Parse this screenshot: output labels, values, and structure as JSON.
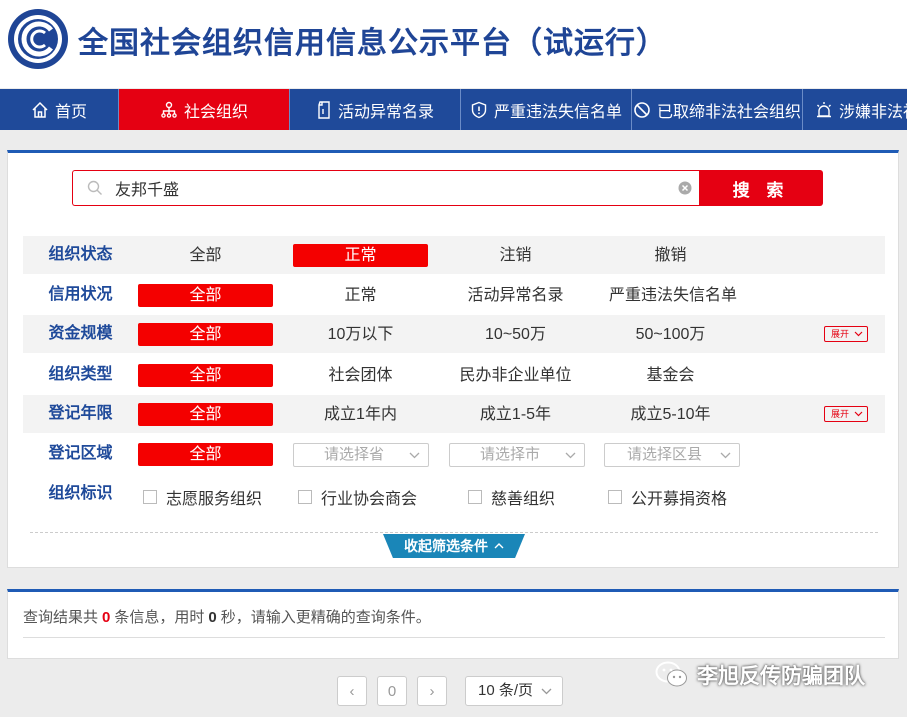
{
  "header": {
    "title": "全国社会组织信用信息公示平台（试运行）",
    "logo_icon": "platform-emblem-icon"
  },
  "nav": {
    "items": [
      {
        "label": "首页",
        "icon": "home-icon"
      },
      {
        "label": "社会组织",
        "icon": "org-tree-icon",
        "active": true
      },
      {
        "label": "活动异常名录",
        "icon": "document-icon"
      },
      {
        "label": "严重违法失信名单",
        "icon": "shield-alert-icon"
      },
      {
        "label": "已取缔非法社会组织",
        "icon": "prohibited-icon"
      },
      {
        "label": "涉嫌非法社",
        "icon": "alarm-light-icon"
      }
    ]
  },
  "search": {
    "value": "友邦千盛",
    "button_label": "搜 索"
  },
  "filters": {
    "status": {
      "label": "组织状态",
      "options": [
        "全部",
        "正常",
        "注销",
        "撤销"
      ],
      "selected": "正常"
    },
    "credit": {
      "label": "信用状况",
      "options": [
        "全部",
        "正常",
        "活动异常名录",
        "严重违法失信名单"
      ],
      "selected": "全部"
    },
    "capital": {
      "label": "资金规模",
      "options": [
        "全部",
        "10万以下",
        "10~50万",
        "50~100万"
      ],
      "selected": "全部",
      "expand_label": "展开"
    },
    "type": {
      "label": "组织类型",
      "options": [
        "全部",
        "社会团体",
        "民办非企业单位",
        "基金会"
      ],
      "selected": "全部"
    },
    "years": {
      "label": "登记年限",
      "options": [
        "全部",
        "成立1年内",
        "成立1-5年",
        "成立5-10年"
      ],
      "selected": "全部",
      "expand_label": "展开"
    },
    "region": {
      "label": "登记区域",
      "all_label": "全部",
      "province_placeholder": "请选择省",
      "city_placeholder": "请选择市",
      "county_placeholder": "请选择区县"
    },
    "tags": {
      "label": "组织标识",
      "options": [
        "志愿服务组织",
        "行业协会商会",
        "慈善组织",
        "公开募捐资格"
      ]
    },
    "collapse_label": "收起筛选条件"
  },
  "result": {
    "prefix": "查询结果共",
    "count": "0",
    "mid": "条信息，用时",
    "time": "0",
    "suffix": "秒，请输入更精确的查询条件。"
  },
  "pagination": {
    "prev": "‹",
    "current": "0",
    "next": "›",
    "page_size": "10 条/页"
  },
  "watermark": {
    "text": "李旭反传防骗团队",
    "icon": "wechat-icon"
  },
  "colors": {
    "primary_blue": "#1f4a9a",
    "accent_red": "#e50012",
    "collapse_teal": "#1a86b8"
  }
}
